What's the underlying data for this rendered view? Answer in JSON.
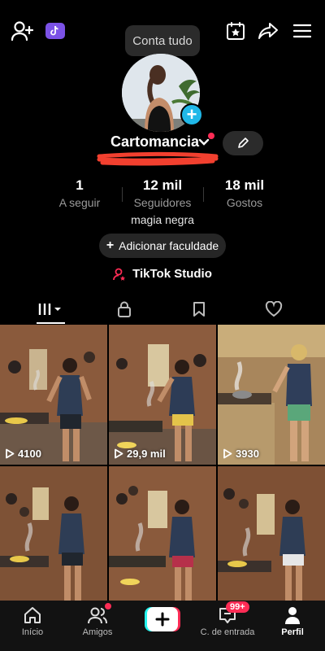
{
  "header": {
    "tooltip": "Conta tudo"
  },
  "profile": {
    "username": "Cartomancia",
    "bio": "magia negra",
    "add_faculty_label": "Adicionar faculdade",
    "studio_label": "TikTok Studio",
    "stats": [
      {
        "value": "1",
        "label": "A seguir"
      },
      {
        "value": "12 mil",
        "label": "Seguidores"
      },
      {
        "value": "18 mil",
        "label": "Gostos"
      }
    ]
  },
  "grid": {
    "videos": [
      {
        "views": "4100"
      },
      {
        "views": "29,9 mil"
      },
      {
        "views": "3930"
      },
      {
        "views": ""
      },
      {
        "views": ""
      },
      {
        "views": ""
      }
    ]
  },
  "nav": {
    "items": [
      {
        "label": "Início"
      },
      {
        "label": "Amigos"
      },
      {
        "label": ""
      },
      {
        "label": "C. de entrada",
        "badge": "99+"
      },
      {
        "label": "Perfil"
      }
    ]
  },
  "colors": {
    "accent": "#fe2c55",
    "add_blue": "#20b8e8",
    "background": "#000000"
  }
}
